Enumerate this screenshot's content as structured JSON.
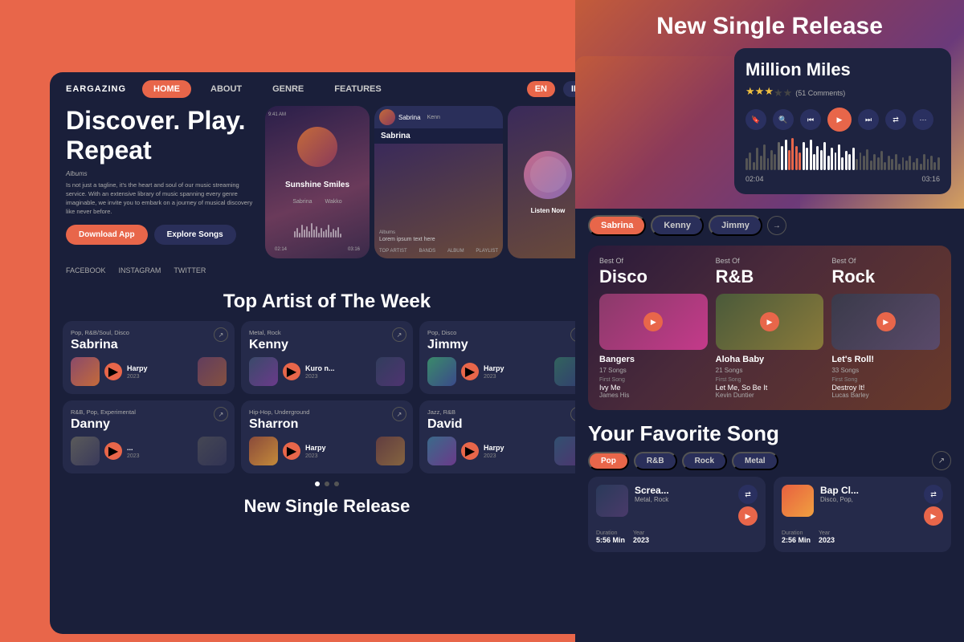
{
  "brand": {
    "logo": "EARGAZING"
  },
  "nav": {
    "home": "HOME",
    "about": "ABOUT",
    "genre": "GENRE",
    "features": "FEATURES",
    "lang_en": "EN",
    "lang_id": "ID"
  },
  "hero": {
    "title": "Discover. Play. Repeat",
    "description": "Is not just a tagline, it's the heart and soul of our music streaming service. With an extensive library of music spanning every genre imaginable, we invite you to embark on a journey of musical discovery like never before.",
    "albums_label": "Albums",
    "btn_download": "Download App",
    "btn_explore": "Explore Songs"
  },
  "social": {
    "facebook": "FACEBOOK",
    "instagram": "INSTAGRAM",
    "twitter": "TWITTER"
  },
  "top_artist": {
    "title": "Top Artist of The Week",
    "artists": [
      {
        "genre": "Pop, R&B/Soul, Disco",
        "name": "Sabrina",
        "album": "Harpy",
        "year": "2023"
      },
      {
        "genre": "Metal, Rock",
        "name": "Kenny",
        "album": "Kuro n...",
        "year": "2023"
      },
      {
        "genre": "Pop, Disco",
        "name": "Jimmy",
        "album": "Harpy",
        "year": "2023"
      },
      {
        "genre": "R&B, Pop, Experimental",
        "name": "Danny",
        "album": "...",
        "year": "2023"
      },
      {
        "genre": "Hip-Hop, Underground",
        "name": "Sharron",
        "album": "Harpy",
        "year": "2023"
      },
      {
        "genre": "Jazz, R&B",
        "name": "David",
        "album": "Harpy",
        "year": "2023"
      }
    ]
  },
  "new_single": {
    "title": "New Single Release",
    "title_bottom": "New Single Release"
  },
  "now_playing": {
    "title": "Million Miles",
    "stars": 3,
    "comments": "51 Comments",
    "time_current": "02:04",
    "time_total": "03:16"
  },
  "artist_tabs": {
    "tabs": [
      "Sabrina",
      "Kenny",
      "Jimmy"
    ],
    "active": "Sabrina"
  },
  "best_of": {
    "sections": [
      {
        "label": "Best Of",
        "genre": "Disco",
        "album": "Bangers",
        "songs_count": "17 Songs",
        "first_song_label": "First Song",
        "first_song": "Ivy Me",
        "first_artist": "James His"
      },
      {
        "label": "Best Of",
        "genre": "R&B",
        "album": "Aloha Baby",
        "songs_count": "21 Songs",
        "first_song_label": "First Song",
        "first_song": "Let Me, So Be It",
        "first_artist": "Kevin Duntier"
      },
      {
        "label": "Best Of",
        "genre": "Rock",
        "album": "Let's Roll!",
        "songs_count": "33 Songs",
        "first_song_label": "First Song",
        "first_song": "Destroy It!",
        "first_artist": "Lucas Barley"
      }
    ]
  },
  "favorite": {
    "title": "Your Favorite Song",
    "filters": [
      "Pop",
      "R&B",
      "Rock",
      "Metal"
    ],
    "active_filter": "Pop",
    "songs": [
      {
        "title": "Screa...",
        "genre": "Metal, Rock",
        "duration_label": "Duration",
        "duration": "5:56 Min",
        "year_label": "Year",
        "year": "2023"
      },
      {
        "title": "Bap Cl...",
        "genre": "Disco, Pop,",
        "duration_label": "Duration",
        "duration": "2:56 Min",
        "year_label": "Year",
        "year": "2023"
      }
    ]
  }
}
